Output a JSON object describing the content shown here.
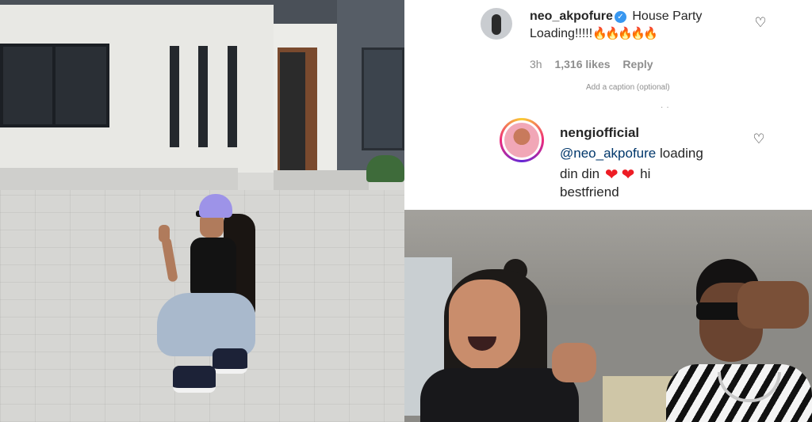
{
  "comment_top": {
    "username": "neo_akpofure",
    "text_line1": "House Party",
    "text_line2": "Loading!!!!!",
    "emoji": [
      "🔥",
      "🔥",
      "🔥",
      "🔥",
      "🔥"
    ],
    "time": "3h",
    "likes": "1,316 likes",
    "reply_label": "Reply"
  },
  "caption_placeholder": "Add a caption (optional)",
  "comment_reply": {
    "username": "nengiofficial",
    "mention": "@neo_akpofure",
    "text_after_mention": "loading",
    "line2_start": "din din",
    "hearts": [
      "❤",
      "❤"
    ],
    "line2_end": "hi",
    "line3": "bestfriend"
  },
  "icons": {
    "verified": "verified-badge-icon",
    "like": "heart-outline-icon"
  },
  "colors": {
    "verified_blue": "#3897f0",
    "mention_blue": "#00376b",
    "meta_grey": "#8e8e8e",
    "heart_red": "#ed1c24"
  }
}
